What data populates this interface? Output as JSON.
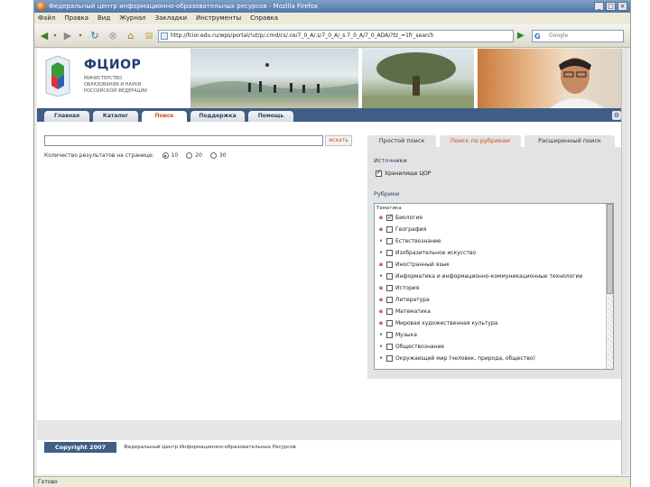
{
  "window": {
    "title": "Федеральный центр информационно-образовательных ресурсов - Mozilla Firefox",
    "controls": [
      "_",
      "□",
      "×"
    ]
  },
  "menu": [
    "Файл",
    "Правка",
    "Вид",
    "Журнал",
    "Закладки",
    "Инструменты",
    "Справка"
  ],
  "nav": {
    "url": "http://fcior.edu.ru/wps/portal/!ut/p/.cmd/cs/.ce/7_0_A/.s/7_0_A/_s.7_0_A/7_0_ADA/?tz_=1fr_search",
    "search_engine": "Google",
    "search_placeholder": "Google"
  },
  "site": {
    "logo_title": "ФЦИОР",
    "logo_subtitle": "Министерство образования и науки Российской Федерации"
  },
  "tabs": [
    {
      "label": "Главная",
      "active": false
    },
    {
      "label": "Каталог",
      "active": false
    },
    {
      "label": "Поиск",
      "active": true
    },
    {
      "label": "Поддержка",
      "active": false
    },
    {
      "label": "Помощь",
      "active": false
    }
  ],
  "search": {
    "button_label": "искать",
    "results_label": "Количество результатов на странице:",
    "options": [
      "10",
      "20",
      "30"
    ],
    "selected": "10"
  },
  "panel": {
    "tabs": [
      "Простой поиск",
      "Поиск по рубрикам",
      "Расширенный поиск"
    ],
    "active_tab": "Поиск по рубрикам",
    "sources_title": "Источники",
    "source_item": "Хранилище ЦОР",
    "rubrics_title": "Рубрики",
    "list_header": "Тематика",
    "items": [
      {
        "label": "Биология",
        "checked": true,
        "marker": "expand"
      },
      {
        "label": "География",
        "checked": false,
        "marker": "expand"
      },
      {
        "label": "Естествознание",
        "checked": false,
        "marker": "dot"
      },
      {
        "label": "Изобразительное искусство",
        "checked": false,
        "marker": "dot"
      },
      {
        "label": "Иностранный язык",
        "checked": false,
        "marker": "expand"
      },
      {
        "label": "Информатика и информационно-коммуникационные технологии",
        "checked": false,
        "marker": "dot"
      },
      {
        "label": "История",
        "checked": false,
        "marker": "expand"
      },
      {
        "label": "Литература",
        "checked": false,
        "marker": "expand"
      },
      {
        "label": "Математика",
        "checked": false,
        "marker": "expand"
      },
      {
        "label": "Мировая художественная культура",
        "checked": false,
        "marker": "expand"
      },
      {
        "label": "Музыка",
        "checked": false,
        "marker": "dot"
      },
      {
        "label": "Обществознание",
        "checked": false,
        "marker": "dot"
      },
      {
        "label": "Окружающий мир (человек, природа, общество)",
        "checked": false,
        "marker": "dot"
      }
    ]
  },
  "footer": {
    "copyright": "Copyright 2007",
    "text": "Федеральный Центр Информационно-образовательных Ресурсов"
  },
  "status": "Готово"
}
